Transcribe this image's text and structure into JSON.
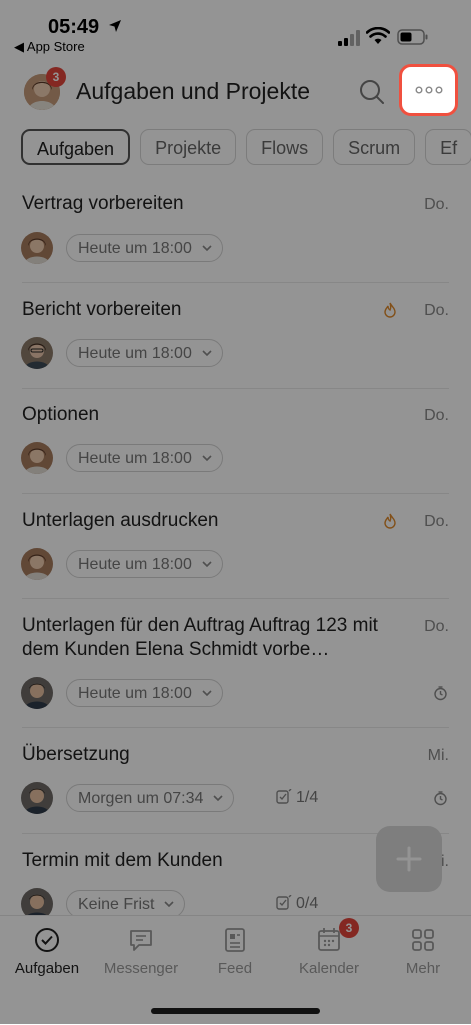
{
  "status": {
    "time": "05:49",
    "back_app": "◀ App Store"
  },
  "header": {
    "title": "Aufgaben und Projekte",
    "badge_count": "3"
  },
  "tabs": [
    "Aufgaben",
    "Projekte",
    "Flows",
    "Scrum",
    "Ef"
  ],
  "tasks": [
    {
      "title": "Vertrag vorbereiten",
      "day": "Do.",
      "deadline": "Heute um 18:00",
      "flame": false,
      "clock": false,
      "checklist": ""
    },
    {
      "title": "Bericht vorbereiten",
      "day": "Do.",
      "deadline": "Heute um 18:00",
      "flame": true,
      "clock": false,
      "checklist": ""
    },
    {
      "title": "Optionen",
      "day": "Do.",
      "deadline": "Heute um 18:00",
      "flame": false,
      "clock": false,
      "checklist": ""
    },
    {
      "title": "Unterlagen ausdrucken",
      "day": "Do.",
      "deadline": "Heute um 18:00",
      "flame": true,
      "clock": false,
      "checklist": ""
    },
    {
      "title": "Unterlagen für den Auftrag Auftrag 123 mit dem Kunden Elena  Schmidt vorbe…",
      "day": "Do.",
      "deadline": "Heute um 18:00",
      "flame": false,
      "clock": true,
      "checklist": ""
    },
    {
      "title": "Übersetzung",
      "day": "Mi.",
      "deadline": "Morgen um 07:34",
      "flame": false,
      "clock": true,
      "checklist": "1/4"
    },
    {
      "title": "Termin mit dem Kunden",
      "day": "Mi.",
      "deadline": "Keine Frist",
      "flame": false,
      "clock": false,
      "checklist": "0/4"
    }
  ],
  "bottom_nav": [
    {
      "label": "Aufgaben",
      "icon": "check-circle-icon",
      "active": true
    },
    {
      "label": "Messenger",
      "icon": "chat-icon",
      "active": false
    },
    {
      "label": "Feed",
      "icon": "feed-icon",
      "active": false
    },
    {
      "label": "Kalender",
      "icon": "calendar-icon",
      "active": false,
      "badge": "3"
    },
    {
      "label": "Mehr",
      "icon": "grid-icon",
      "active": false
    }
  ],
  "colors": {
    "accent_red": "#f0503f",
    "badge_red": "#e4453c",
    "flame": "#e08a2c"
  }
}
